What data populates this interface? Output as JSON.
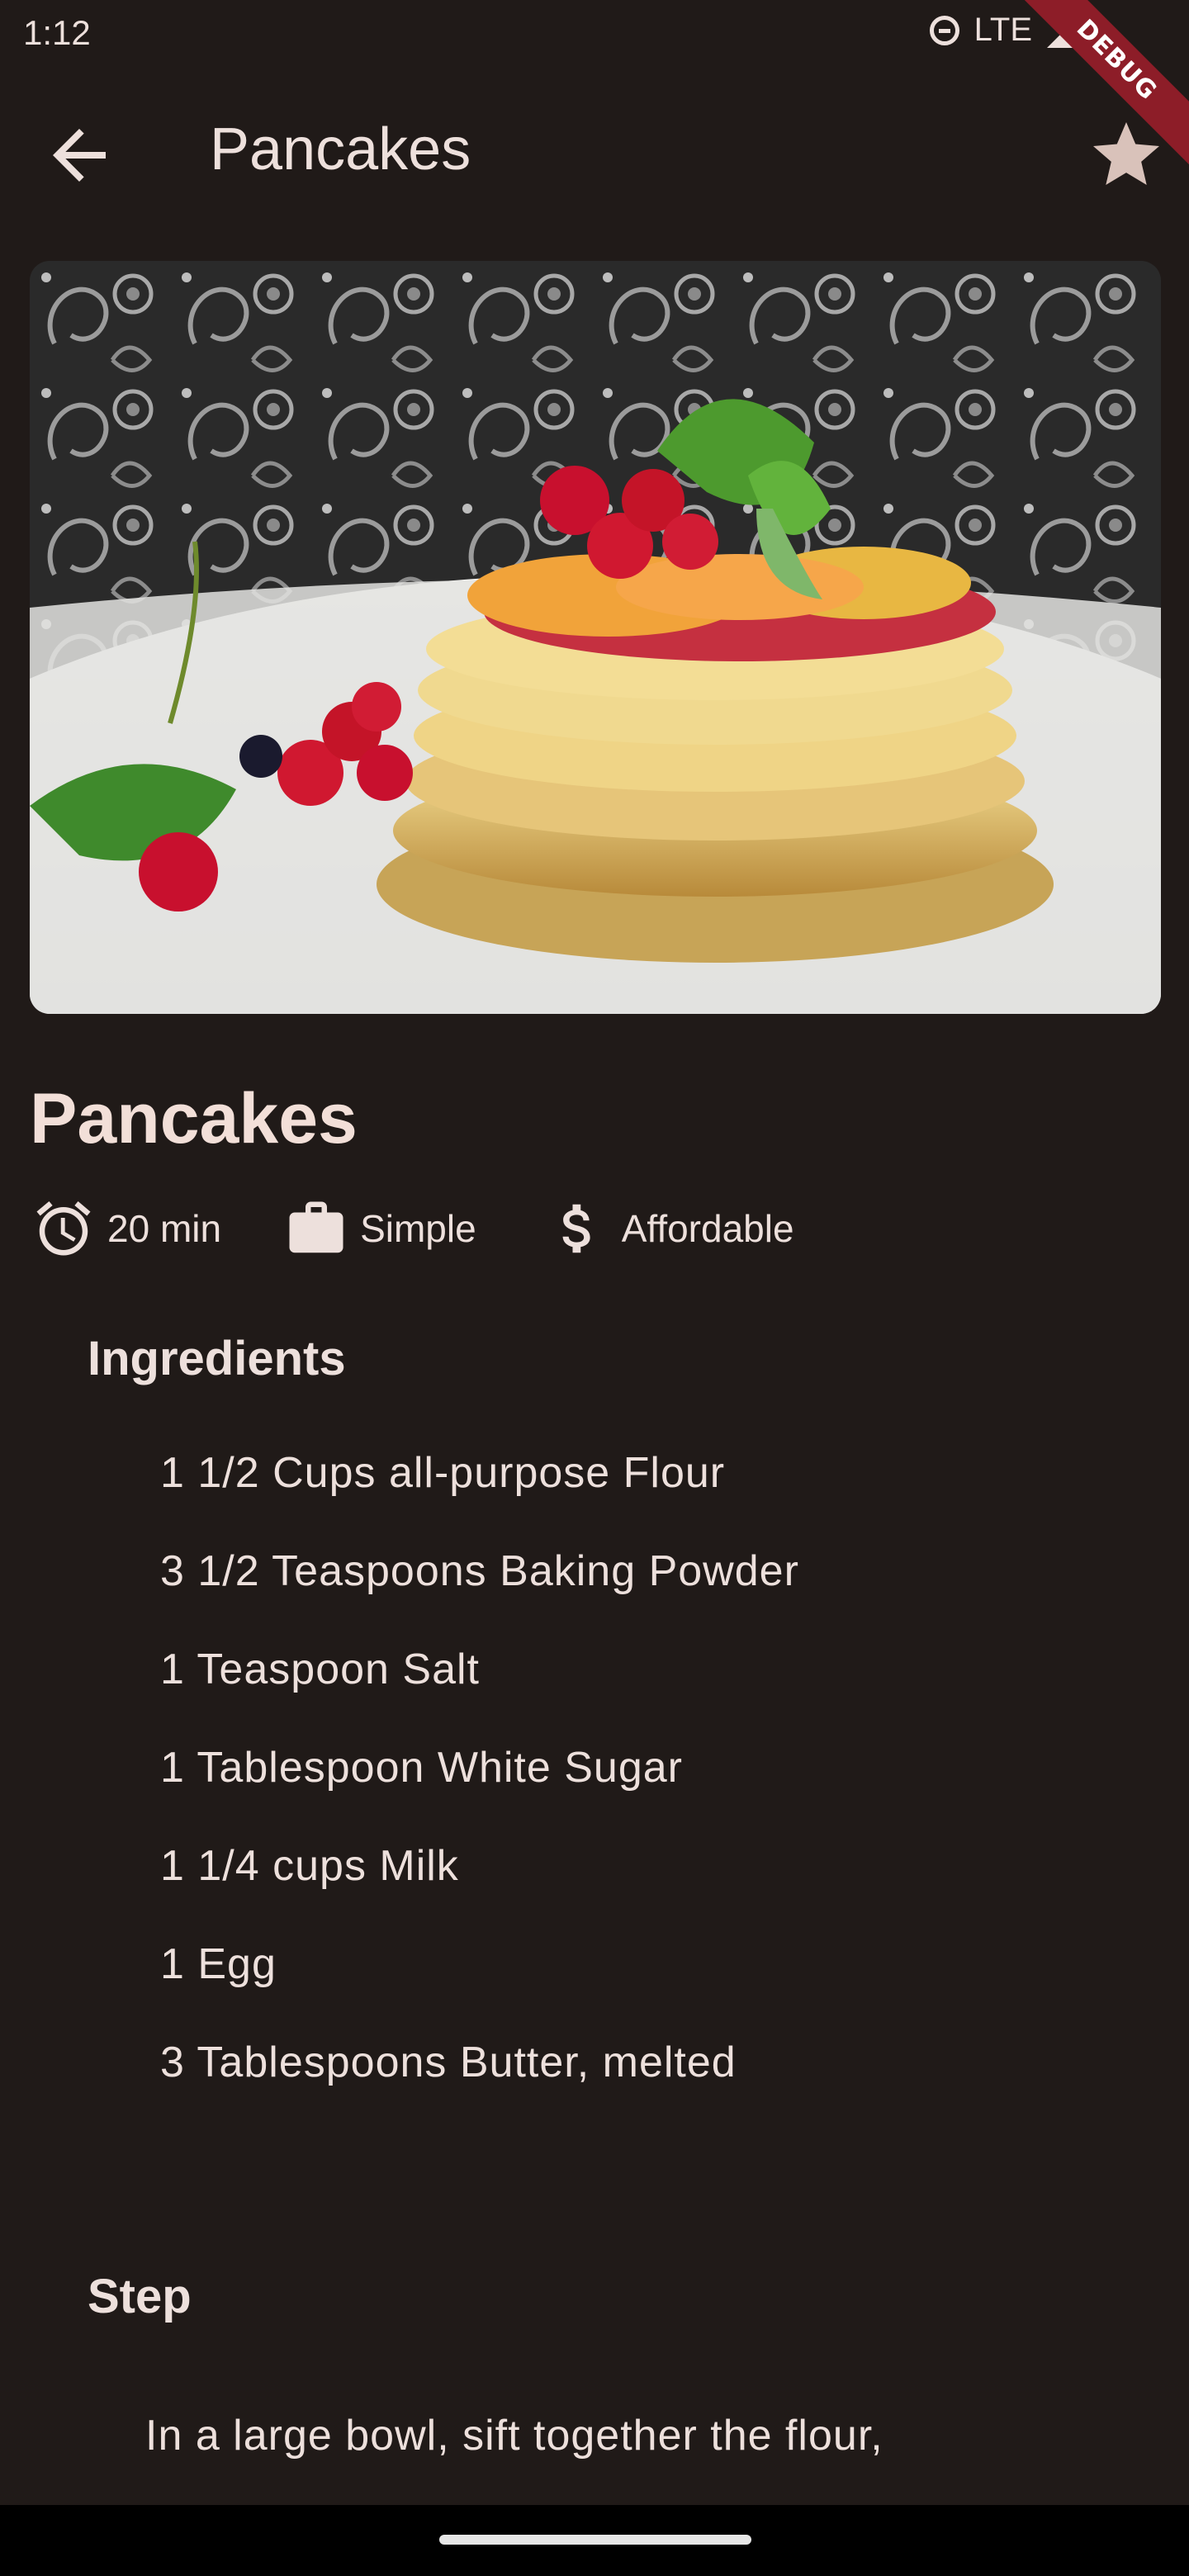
{
  "status_bar": {
    "time": "1:12",
    "network": "LTE"
  },
  "debug_banner": {
    "label": "DEBUG",
    "color": "#8d1d28"
  },
  "app_bar": {
    "title": "Pancakes",
    "back_icon": "arrow-back-icon",
    "favorite_icon": "star-icon"
  },
  "hero_image": {
    "alt": "Pancakes"
  },
  "recipe": {
    "title": "Pancakes",
    "duration": "20 min",
    "complexity": "Simple",
    "affordability": "Affordable",
    "ingredients_title": "Ingredients",
    "ingredients": [
      "1 1/2 Cups all-purpose Flour",
      "3 1/2 Teaspoons Baking Powder",
      "1 Teaspoon Salt",
      "1 Tablespoon White Sugar",
      "1 1/4 cups Milk",
      "1 Egg",
      "3 Tablespoons Butter, melted"
    ],
    "steps_title": "Step",
    "first_step": "In a large bowl, sift together the flour,"
  },
  "colors": {
    "background": "#201a18",
    "text": "#ede0dc",
    "title": "#f2dfd8"
  }
}
